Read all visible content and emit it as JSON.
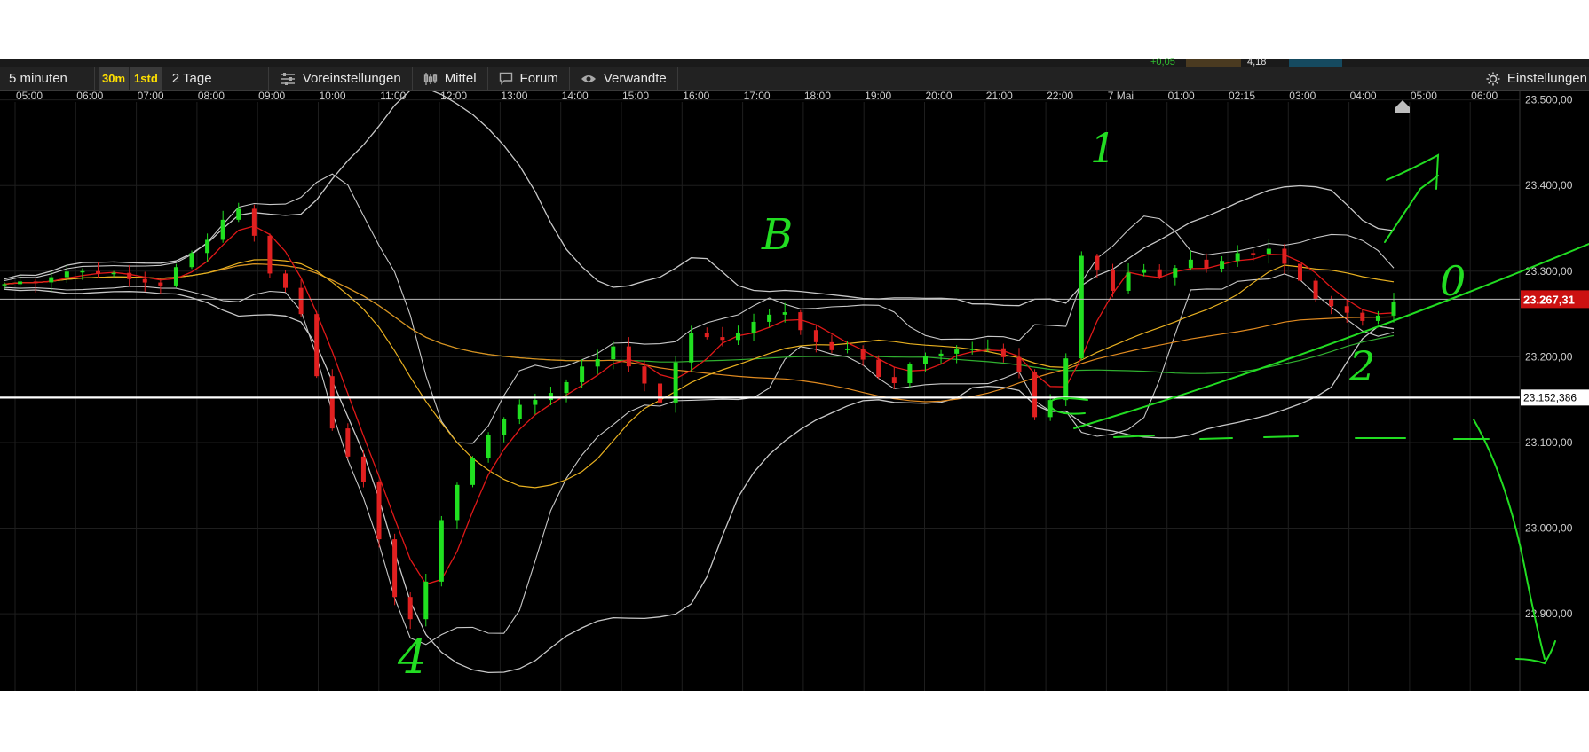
{
  "topbar": {
    "left_value": "+0,05",
    "right_value": "4,18"
  },
  "toolbar": {
    "interval_label": "5 minuten",
    "badge_30m": "30m",
    "badge_1std": "1std",
    "range_label": "2 Tage",
    "presets_label": "Voreinstellungen",
    "average_label": "Mittel",
    "forum_label": "Forum",
    "related_label": "Verwandte",
    "settings_label": "Einstellungen"
  },
  "colors": {
    "background": "#000000",
    "gridline": "#1e1e1e",
    "bollinger": "#c8c8c8",
    "sma_short": "#e01818",
    "sma_mid": "#e8b020",
    "sma_long_orange": "#e08a20",
    "sma_long_green": "#30b030",
    "candle_up": "#20e020",
    "candle_down": "#e02020",
    "annotation": "#22dd22",
    "badge_yellow": "#ffe000",
    "current_price_bg": "#cc1111"
  },
  "chart_data": {
    "type": "candlestick",
    "x_tick_labels": [
      "05:00",
      "06:00",
      "07:00",
      "08:00",
      "09:00",
      "10:00",
      "11:00",
      "12:00",
      "13:00",
      "14:00",
      "15:00",
      "16:00",
      "17:00",
      "18:00",
      "19:00",
      "20:00",
      "21:00",
      "22:00",
      "7 Mai",
      "01:00",
      "02:15",
      "03:00",
      "04:00",
      "05:00",
      "06:00"
    ],
    "y_tick_labels": [
      "23.500,00",
      "23.400,00",
      "23.300,00",
      "23.200,00",
      "23.100,00",
      "23.000,00",
      "22.900,00"
    ],
    "y_ticks": [
      23500,
      23400,
      23300,
      23200,
      23100,
      23000,
      22900
    ],
    "ylim": [
      22810,
      23510
    ],
    "current_price": 23267.31,
    "current_price_label": "23.267,31",
    "reference_price": 23152.386,
    "reference_price_label": "23.152,386",
    "price_path": [
      [
        0,
        23285
      ],
      [
        2,
        23290
      ],
      [
        4,
        23300
      ],
      [
        6,
        23300
      ],
      [
        8,
        23290
      ],
      [
        10,
        23285
      ],
      [
        12,
        23320
      ],
      [
        14,
        23360
      ],
      [
        15,
        23375
      ],
      [
        16,
        23340
      ],
      [
        17,
        23300
      ],
      [
        18,
        23280
      ],
      [
        19,
        23250
      ],
      [
        20,
        23180
      ],
      [
        21,
        23120
      ],
      [
        22,
        23080
      ],
      [
        23,
        23050
      ],
      [
        24,
        22990
      ],
      [
        25,
        22920
      ],
      [
        26,
        22890
      ],
      [
        27,
        22940
      ],
      [
        28,
        23010
      ],
      [
        29,
        23050
      ],
      [
        30,
        23080
      ],
      [
        31,
        23110
      ],
      [
        32,
        23130
      ],
      [
        33,
        23140
      ],
      [
        34,
        23150
      ],
      [
        35,
        23160
      ],
      [
        36,
        23170
      ],
      [
        37,
        23190
      ],
      [
        38,
        23200
      ],
      [
        39,
        23210
      ],
      [
        40,
        23190
      ],
      [
        41,
        23170
      ],
      [
        42,
        23150
      ],
      [
        43,
        23190
      ],
      [
        44,
        23230
      ],
      [
        45,
        23220
      ],
      [
        46,
        23220
      ],
      [
        47,
        23230
      ],
      [
        48,
        23240
      ],
      [
        49,
        23250
      ],
      [
        50,
        23250
      ],
      [
        51,
        23230
      ],
      [
        52,
        23220
      ],
      [
        53,
        23210
      ],
      [
        54,
        23210
      ],
      [
        55,
        23200
      ],
      [
        56,
        23180
      ],
      [
        57,
        23170
      ],
      [
        58,
        23190
      ],
      [
        59,
        23200
      ],
      [
        60,
        23200
      ],
      [
        61,
        23210
      ],
      [
        62,
        23210
      ],
      [
        63,
        23210
      ],
      [
        64,
        23200
      ],
      [
        65,
        23180
      ],
      [
        66,
        23130
      ],
      [
        67,
        23150
      ],
      [
        68,
        23200
      ],
      [
        69,
        23320
      ],
      [
        70,
        23300
      ],
      [
        71,
        23280
      ],
      [
        72,
        23300
      ],
      [
        73,
        23300
      ],
      [
        74,
        23290
      ],
      [
        75,
        23300
      ],
      [
        76,
        23310
      ],
      [
        77,
        23300
      ],
      [
        78,
        23310
      ],
      [
        79,
        23320
      ],
      [
        80,
        23320
      ],
      [
        81,
        23330
      ],
      [
        82,
        23310
      ],
      [
        83,
        23290
      ],
      [
        84,
        23270
      ],
      [
        85,
        23260
      ],
      [
        86,
        23250
      ],
      [
        87,
        23240
      ],
      [
        88,
        23250
      ],
      [
        89,
        23260
      ]
    ],
    "n_candles": 90
  },
  "annotations": {
    "label_1": "1",
    "label_3": "B",
    "label_4": "4",
    "label_0": "0",
    "label_2": "2"
  }
}
